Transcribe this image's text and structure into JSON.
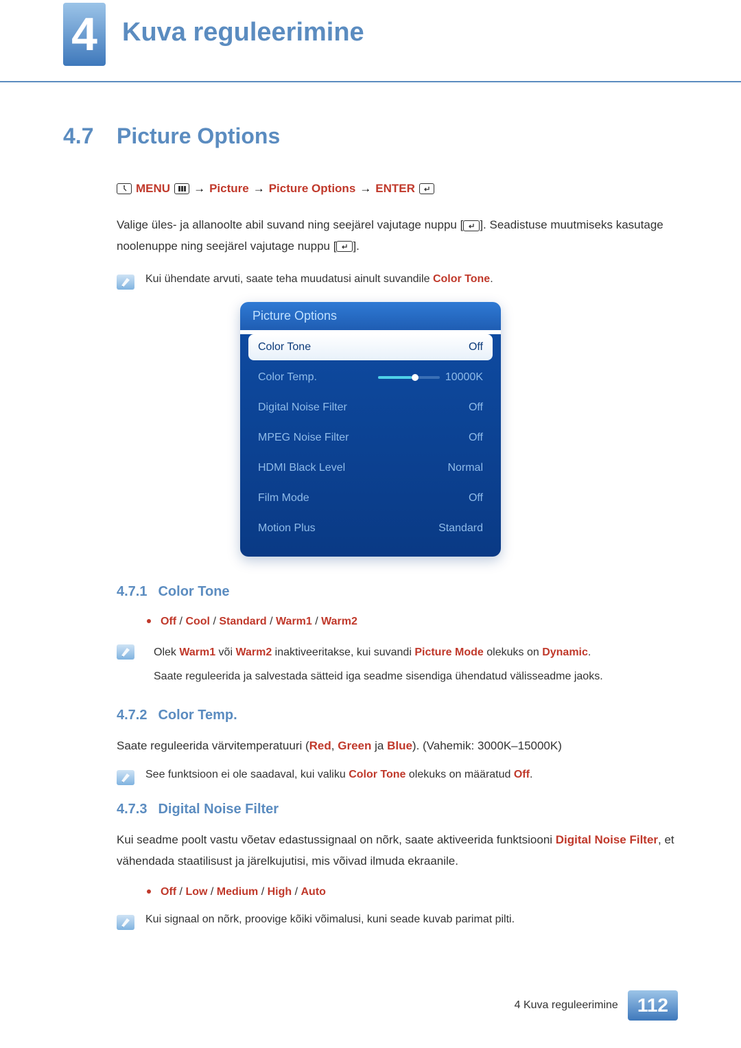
{
  "chapter": {
    "number": "4",
    "title": "Kuva reguleerimine"
  },
  "section": {
    "number": "4.7",
    "title": "Picture Options"
  },
  "nav": {
    "menu": "MENU",
    "step1": "Picture",
    "step2": "Picture Options",
    "enter": "ENTER",
    "arrow": "→"
  },
  "intro": {
    "line1a": "Valige üles- ja allanoolte abil suvand ning seejärel vajutage nuppu [",
    "line1b": "]. Seadistuse muutmiseks kasutage noolenuppe ning seejärel vajutage nuppu [",
    "line1c": "]."
  },
  "note1": {
    "text_a": "Kui ühendate arvuti, saate teha muudatusi ainult suvandile ",
    "text_b": "Color Tone",
    "text_c": "."
  },
  "osd": {
    "title": "Picture Options",
    "items": [
      {
        "label": "Color Tone",
        "value": "Off",
        "selected": true
      },
      {
        "label": "Color Temp.",
        "value": "10000K",
        "slider": true
      },
      {
        "label": "Digital Noise Filter",
        "value": "Off"
      },
      {
        "label": "MPEG Noise Filter",
        "value": "Off"
      },
      {
        "label": "HDMI Black Level",
        "value": "Normal"
      },
      {
        "label": "Film Mode",
        "value": "Off"
      },
      {
        "label": "Motion Plus",
        "value": "Standard"
      }
    ]
  },
  "sub471": {
    "num": "4.7.1",
    "title": "Color Tone",
    "opts": [
      "Off",
      "Cool",
      "Standard",
      "Warm1",
      "Warm2"
    ],
    "sep": " / ",
    "note_li1_a": "Olek ",
    "note_li1_b": "Warm1",
    "note_li1_c": " või ",
    "note_li1_d": "Warm2",
    "note_li1_e": " inaktiveeritakse, kui suvandi ",
    "note_li1_f": "Picture Mode",
    "note_li1_g": " olekuks on ",
    "note_li1_h": "Dynamic",
    "note_li1_i": ".",
    "note_li2": "Saate reguleerida ja salvestada sätteid iga seadme sisendiga ühendatud välisseadme jaoks."
  },
  "sub472": {
    "num": "4.7.2",
    "title": "Color Temp.",
    "para_a": "Saate reguleerida värvitemperatuuri (",
    "para_b": "Red",
    "para_c": ", ",
    "para_d": "Green",
    "para_e": " ja ",
    "para_f": "Blue",
    "para_g": "). (Vahemik: 3000K–15000K)",
    "note_a": "See funktsioon ei ole saadaval, kui valiku ",
    "note_b": "Color Tone",
    "note_c": " olekuks on määratud ",
    "note_d": "Off",
    "note_e": "."
  },
  "sub473": {
    "num": "4.7.3",
    "title": "Digital Noise Filter",
    "para_a": "Kui seadme poolt vastu võetav edastussignaal on nõrk, saate aktiveerida funktsiooni ",
    "para_b": "Digital Noise Filter",
    "para_c": ", et vähendada staatilisust ja järelkujutisi, mis võivad ilmuda ekraanile.",
    "opts": [
      "Off",
      "Low",
      "Medium",
      "High",
      "Auto"
    ],
    "sep": " / ",
    "note": "Kui signaal on nõrk, proovige kõiki võimalusi, kuni seade kuvab parimat pilti."
  },
  "footer": {
    "text_a": "4 Kuva reguleerimine",
    "page": "112"
  }
}
